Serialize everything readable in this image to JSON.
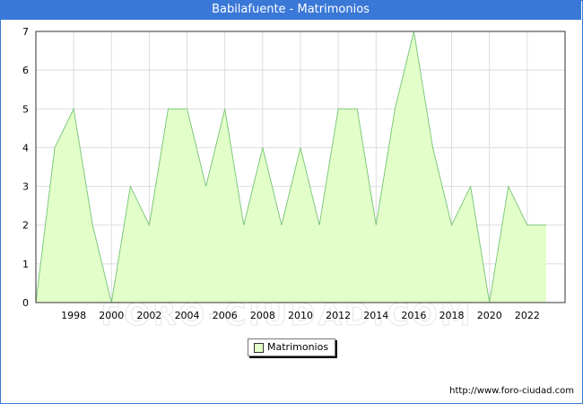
{
  "title": "Babilafuente - Matrimonios",
  "footer_url": "http://www.foro-ciudad.com",
  "watermark": "FORO-CIUDAD.COM",
  "chart_data": {
    "type": "area",
    "title": "Babilafuente - Matrimonios",
    "x": [
      1996,
      1997,
      1998,
      1999,
      2000,
      2001,
      2002,
      2003,
      2004,
      2005,
      2006,
      2007,
      2008,
      2009,
      2010,
      2011,
      2012,
      2013,
      2014,
      2015,
      2016,
      2017,
      2018,
      2019,
      2020,
      2021,
      2022,
      2023
    ],
    "series": [
      {
        "name": "Matrimonios",
        "values": [
          0,
          4,
          5,
          2,
          0,
          3,
          2,
          5,
          5,
          3,
          5,
          2,
          4,
          2,
          4,
          2,
          5,
          5,
          2,
          5,
          7,
          4,
          2,
          3,
          0,
          3,
          2,
          2
        ]
      }
    ],
    "xticks": [
      1998,
      2000,
      2002,
      2004,
      2006,
      2008,
      2010,
      2012,
      2014,
      2016,
      2018,
      2020,
      2022
    ],
    "yticks": [
      0,
      1,
      2,
      3,
      4,
      5,
      6,
      7
    ],
    "xlim": [
      1996,
      2024
    ],
    "ylim": [
      0,
      7
    ],
    "grid": true,
    "legend_position": "bottom-center",
    "colors": {
      "fill": "#e3ffc9",
      "line": "#7fc87f",
      "grid": "#dddddd",
      "title_bg": "#3a78d8"
    }
  }
}
